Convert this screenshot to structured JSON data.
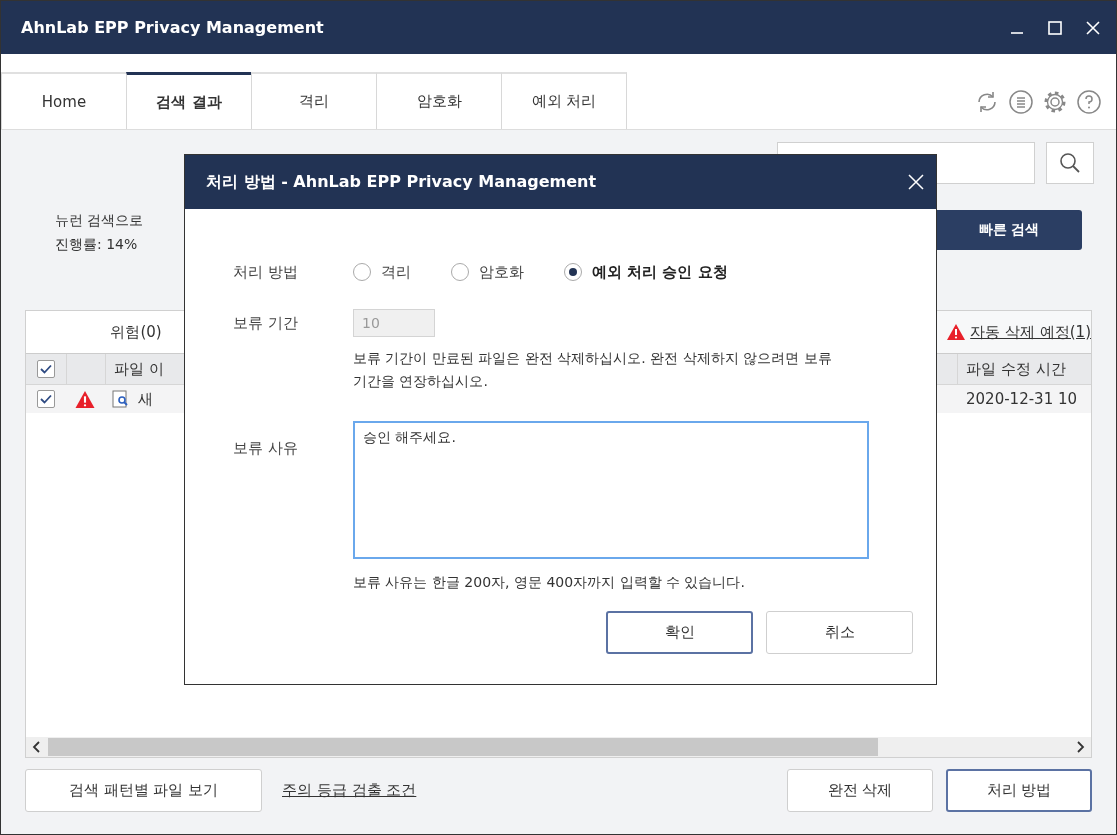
{
  "window": {
    "title": "AhnLab EPP Privacy Management"
  },
  "tabs": [
    {
      "label": "Home",
      "selected": false
    },
    {
      "label": "검색 결과",
      "selected": true
    },
    {
      "label": "격리",
      "selected": false
    },
    {
      "label": "암호화",
      "selected": false
    },
    {
      "label": "예외 처리",
      "selected": false
    }
  ],
  "scan": {
    "message": "뉴런 검색으로",
    "progress": "진행률: 14%"
  },
  "quick_search_button": "빠른 검색",
  "results": {
    "tab": "위험(0)",
    "auto_delete_link": "자동 삭제 예정(1)",
    "all_checked": true,
    "columns": [
      "파일 이",
      "파일 수정 시간"
    ],
    "rows": [
      {
        "checked": true,
        "name": "새",
        "modified": "2020-12-31 10"
      }
    ]
  },
  "bottom": {
    "pattern_button": "검색 패턴별 파일 보기",
    "criteria_link": "주의 등급 검출 조건",
    "delete_button": "완전 삭제",
    "action_button": "처리 방법"
  },
  "dialog": {
    "title": "처리 방법 - AhnLab EPP Privacy Management",
    "method_label": "처리 방법",
    "options": [
      {
        "label": "격리",
        "selected": false
      },
      {
        "label": "암호화",
        "selected": false
      },
      {
        "label": "예외 처리 승인 요청",
        "selected": true
      }
    ],
    "period_label": "보류 기간",
    "period_value": "10",
    "period_note": "보류 기간이 만료된 파일은 완전 삭제하십시오. 완전 삭제하지 않으려면 보류 기간을 연장하십시오.",
    "reason_label": "보류 사유",
    "reason_value": "승인 해주세요.",
    "reason_note": "보류 사유는 한글 200자, 영문 400자까지 입력할 수 있습니다.",
    "buttons": [
      {
        "label": "확인",
        "kind": "primary"
      },
      {
        "label": "취소",
        "kind": "secondary"
      }
    ]
  }
}
